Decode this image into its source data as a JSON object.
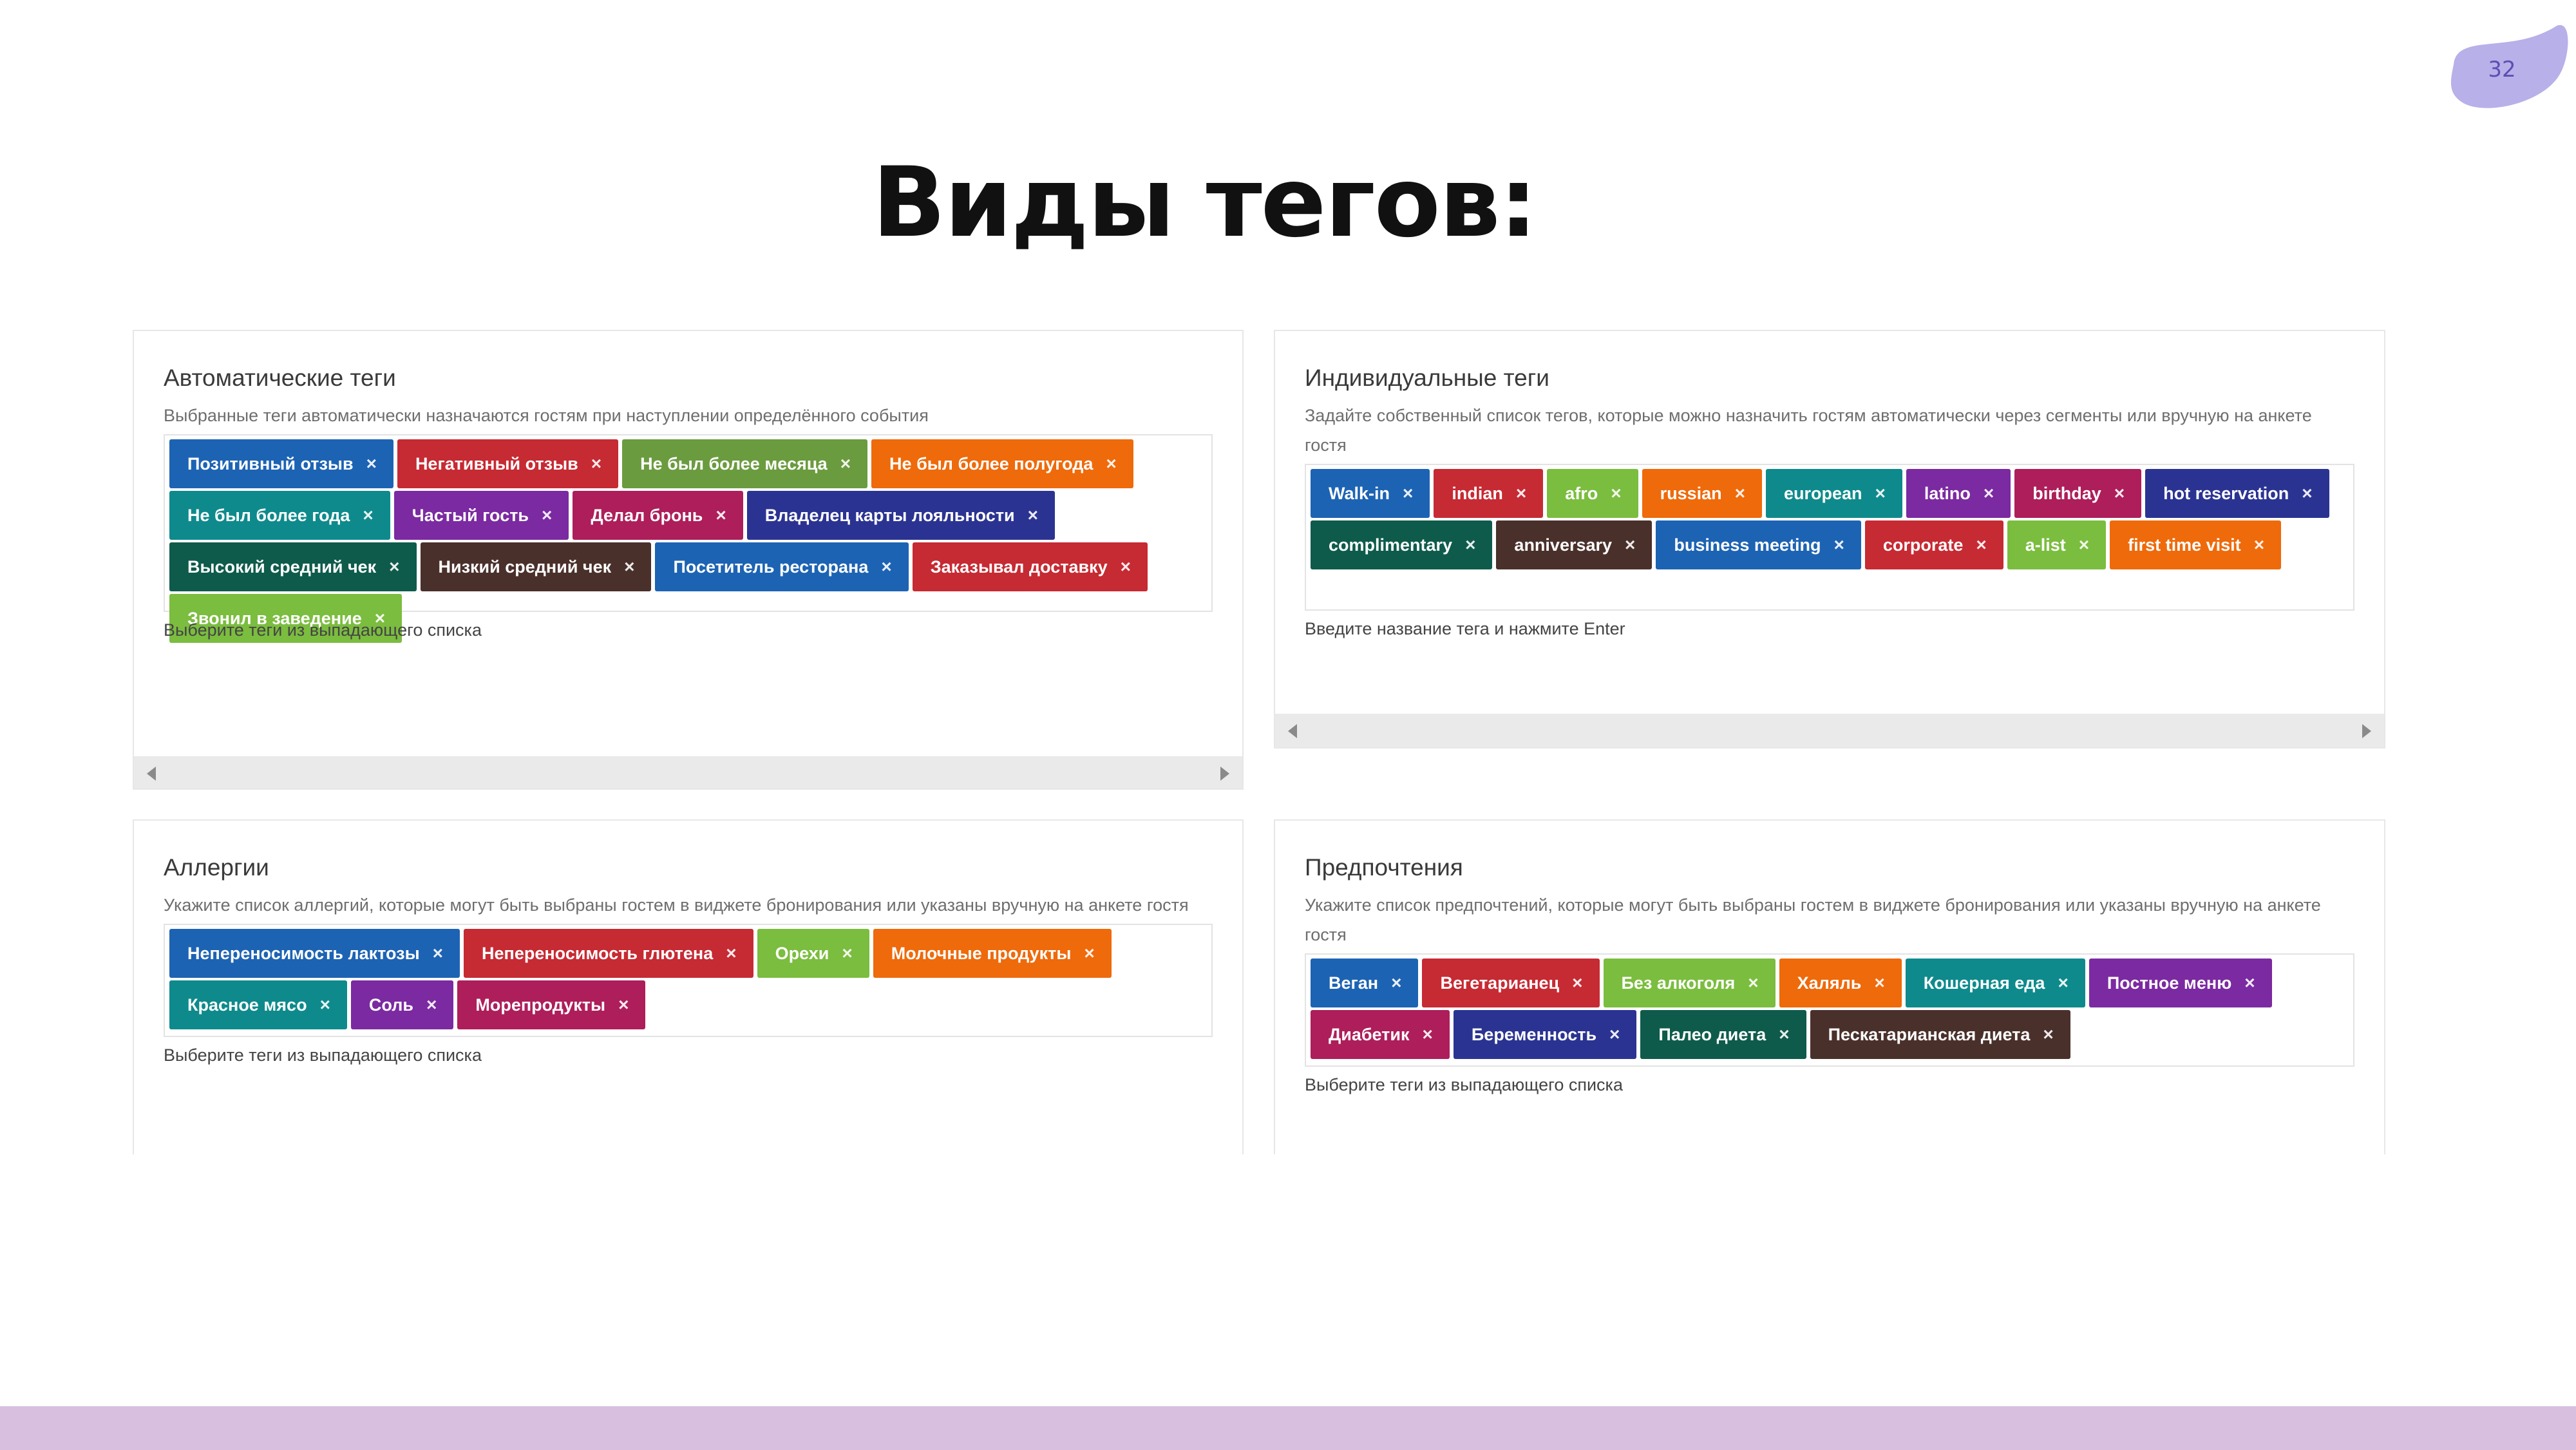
{
  "page_number": "32",
  "title": "Виды тегов:",
  "colors": {
    "blue": "#1d63b3",
    "red": "#c62a33",
    "olive": "#6b9b3f",
    "orange": "#ee6a0b",
    "teal": "#0e8a8c",
    "purple": "#7b2aa1",
    "crimson": "#ad1e5b",
    "navy": "#2b3392",
    "dark_green": "#0e5b4c",
    "brown": "#4a302b",
    "lime": "#7bbd3f",
    "accent_blob": "#b8b0e8",
    "footer": "#d8bfdf"
  },
  "panels": [
    {
      "id": "auto",
      "title": "Автоматические теги",
      "description": "Выбранные теги автоматически назначаются гостям при наступлении определённого события",
      "hint": "Выберите теги из выпадающего списка",
      "tags": [
        {
          "label": "Позитивный отзыв",
          "color": "#1d63b3"
        },
        {
          "label": "Негативный отзыв",
          "color": "#c62a33"
        },
        {
          "label": "Не был более месяца",
          "color": "#6b9b3f"
        },
        {
          "label": "Не был более полугода",
          "color": "#ee6a0b"
        },
        {
          "label": "Не был более года",
          "color": "#0e8a8c"
        },
        {
          "label": "Частый гость",
          "color": "#7b2aa1"
        },
        {
          "label": "Делал бронь",
          "color": "#ad1e5b"
        },
        {
          "label": "Владелец карты лояльности",
          "color": "#2b3392"
        },
        {
          "label": "Высокий средний чек",
          "color": "#0e5b4c"
        },
        {
          "label": "Низкий средний чек",
          "color": "#4a302b"
        },
        {
          "label": "Посетитель ресторана",
          "color": "#1d63b3"
        },
        {
          "label": "Заказывал доставку",
          "color": "#c62a33"
        },
        {
          "label": "Звонил в заведение",
          "color": "#7bbd3f"
        }
      ]
    },
    {
      "id": "individual",
      "title": "Индивидуальные теги",
      "description": "Задайте собственный список тегов, которые можно назначить гостям автоматически через сегменты или вручную на анкете гостя",
      "hint": "Введите название тега и нажмите Enter",
      "tags": [
        {
          "label": "Walk-in",
          "color": "#1d63b3"
        },
        {
          "label": "indian",
          "color": "#c62a33"
        },
        {
          "label": "afro",
          "color": "#7bbd3f"
        },
        {
          "label": "russian",
          "color": "#ee6a0b"
        },
        {
          "label": "european",
          "color": "#0e8a8c"
        },
        {
          "label": "latino",
          "color": "#7b2aa1"
        },
        {
          "label": "birthday",
          "color": "#ad1e5b"
        },
        {
          "label": "hot reservation",
          "color": "#2b3392"
        },
        {
          "label": "complimentary",
          "color": "#0e5b4c"
        },
        {
          "label": "anniversary",
          "color": "#4a302b"
        },
        {
          "label": "business meeting",
          "color": "#1d63b3"
        },
        {
          "label": "corporate",
          "color": "#c62a33"
        },
        {
          "label": "a-list",
          "color": "#7bbd3f"
        },
        {
          "label": "first time visit",
          "color": "#ee6a0b"
        }
      ]
    },
    {
      "id": "allergies",
      "title": "Аллергии",
      "description": "Укажите список аллергий, которые могут быть выбраны гостем в виджете бронирования или указаны вручную на анкете гостя",
      "hint": "Выберите теги из выпадающего списка",
      "tags": [
        {
          "label": "Непереносимость лактозы",
          "color": "#1d63b3"
        },
        {
          "label": "Непереносимость глютена",
          "color": "#c62a33"
        },
        {
          "label": "Орехи",
          "color": "#7bbd3f"
        },
        {
          "label": "Молочные продукты",
          "color": "#ee6a0b"
        },
        {
          "label": "Красное мясо",
          "color": "#0e8a8c"
        },
        {
          "label": "Соль",
          "color": "#7b2aa1"
        },
        {
          "label": "Морепродукты",
          "color": "#ad1e5b"
        }
      ]
    },
    {
      "id": "preferences",
      "title": "Предпочтения",
      "description": "Укажите список предпочтений, которые могут быть выбраны гостем в виджете бронирования или указаны вручную на анкете гостя",
      "hint": "Выберите теги из выпадающего списка",
      "tags": [
        {
          "label": "Веган",
          "color": "#1d63b3"
        },
        {
          "label": "Вегетарианец",
          "color": "#c62a33"
        },
        {
          "label": "Без алкоголя",
          "color": "#7bbd3f"
        },
        {
          "label": "Халяль",
          "color": "#ee6a0b"
        },
        {
          "label": "Кошерная еда",
          "color": "#0e8a8c"
        },
        {
          "label": "Постное меню",
          "color": "#7b2aa1"
        },
        {
          "label": "Диабетик",
          "color": "#ad1e5b"
        },
        {
          "label": "Беременность",
          "color": "#2b3392"
        },
        {
          "label": "Палео диета",
          "color": "#0e5b4c"
        },
        {
          "label": "Пескатарианская диета",
          "color": "#4a302b"
        }
      ]
    }
  ],
  "tag_remove_glyph": "×",
  "icons": {
    "scroll_left": "arrow-left-icon",
    "scroll_right": "arrow-right-icon"
  }
}
